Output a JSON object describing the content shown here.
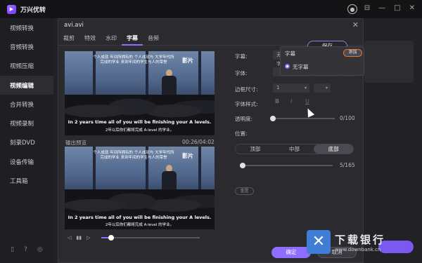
{
  "app": {
    "title": "万兴优转"
  },
  "titlebar": {
    "minimize": "⊟",
    "restore": "—",
    "maximize": "□",
    "close": "✕"
  },
  "sidebar": {
    "items": [
      {
        "label": "视频转换"
      },
      {
        "label": "音频转换"
      },
      {
        "label": "视频压缩"
      },
      {
        "label": "视频编辑"
      },
      {
        "label": "合并转换"
      },
      {
        "label": "视频录制"
      },
      {
        "label": "刻录DVD"
      },
      {
        "label": "设备传输"
      },
      {
        "label": "工具箱"
      }
    ],
    "active_index": 3
  },
  "dialog": {
    "title": "avi.avi",
    "tabs": [
      "裁剪",
      "特效",
      "水印",
      "字幕",
      "音频"
    ],
    "active_tab": "字幕",
    "video": {
      "subtitle_top": "个人成就 年间所拥有的 个人成就与 大学年代所完成的学业 来到年间的学生与人的荣誉",
      "watermark": "影片",
      "subtitle_en": "In 2 years time all of you will be finishing your A levels.",
      "subtitle_cn": "2年以后你们都将完成 A-level 的学业。"
    },
    "preview": {
      "label": "输出预览",
      "time": "00:26/04:02"
    },
    "player": {
      "prev": "◁",
      "play": "▮▮",
      "next": "▷",
      "progress": 0.1
    },
    "form": {
      "subtitle_label": "字幕:",
      "subtitle_value": "无字",
      "font_label": "字体:",
      "border_label": "边框尺寸:",
      "border_value": "1",
      "style_label": "字体样式:",
      "style_bold": "B",
      "style_italic": "I",
      "style_underline": "U",
      "opacity_label": "透明度:",
      "opacity_value": "0/100",
      "opacity_level": 0,
      "position_label": "位置:",
      "positions": [
        "顶部",
        "中部",
        "底部"
      ],
      "position_selected": "底部",
      "position_value": "5/165",
      "position_level": 0.03,
      "reset": "重置"
    },
    "popup": {
      "title": "字幕",
      "add": "添加",
      "option": "无字幕"
    },
    "save": "保存",
    "ok": "确定",
    "cancel": "取消"
  },
  "watermark_site": {
    "name": "下载银行",
    "url": "www.downbank.cn"
  }
}
